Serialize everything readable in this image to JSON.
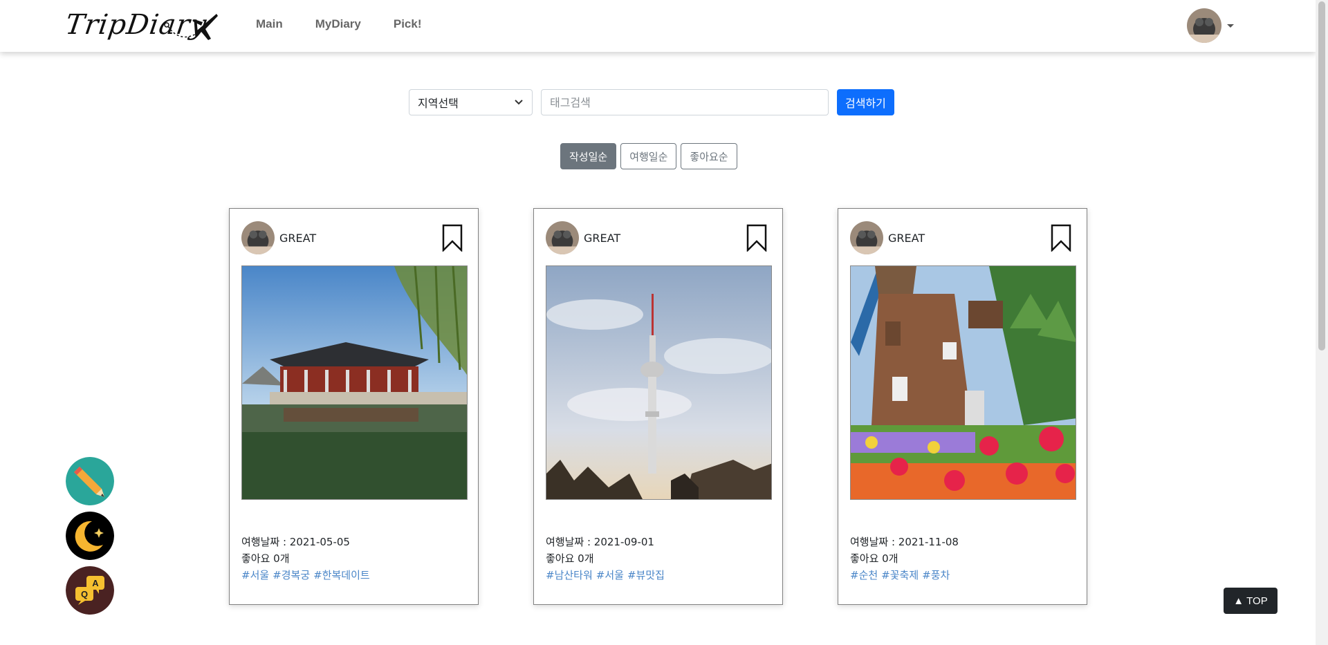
{
  "brand": {
    "logo_text": "TripDiary"
  },
  "nav": {
    "links": [
      "Main",
      "MyDiary",
      "Pick!"
    ]
  },
  "search": {
    "region_selected": "지역선택",
    "tag_placeholder": "태그검색",
    "button_label": "검색하기"
  },
  "sort": {
    "options": [
      "작성일순",
      "여행일순",
      "좋아요순"
    ],
    "active_index": 0
  },
  "cards": [
    {
      "username": "GREAT",
      "trip_date_label": "여행날짜 : 2021-05-05",
      "likes_label": "좋아요 0개",
      "tags": [
        "#서울",
        "#경복궁",
        "#한복데이트"
      ]
    },
    {
      "username": "GREAT",
      "trip_date_label": "여행날짜 : 2021-09-01",
      "likes_label": "좋아요 0개",
      "tags": [
        "#남산타워",
        "#서울",
        "#뷰맛집"
      ]
    },
    {
      "username": "GREAT",
      "trip_date_label": "여행날짜 : 2021-11-08",
      "likes_label": "좋아요 0개",
      "tags": [
        "#순천",
        "#꽃축제",
        "#풍차"
      ]
    }
  ],
  "floating": {
    "top_label": "TOP",
    "icons": [
      "pencil-icon",
      "moon-icon",
      "qa-icon"
    ]
  },
  "colors": {
    "primary": "#0d6efd",
    "secondary": "#6c757d",
    "tag": "#4a86c8",
    "dark": "#212529"
  }
}
